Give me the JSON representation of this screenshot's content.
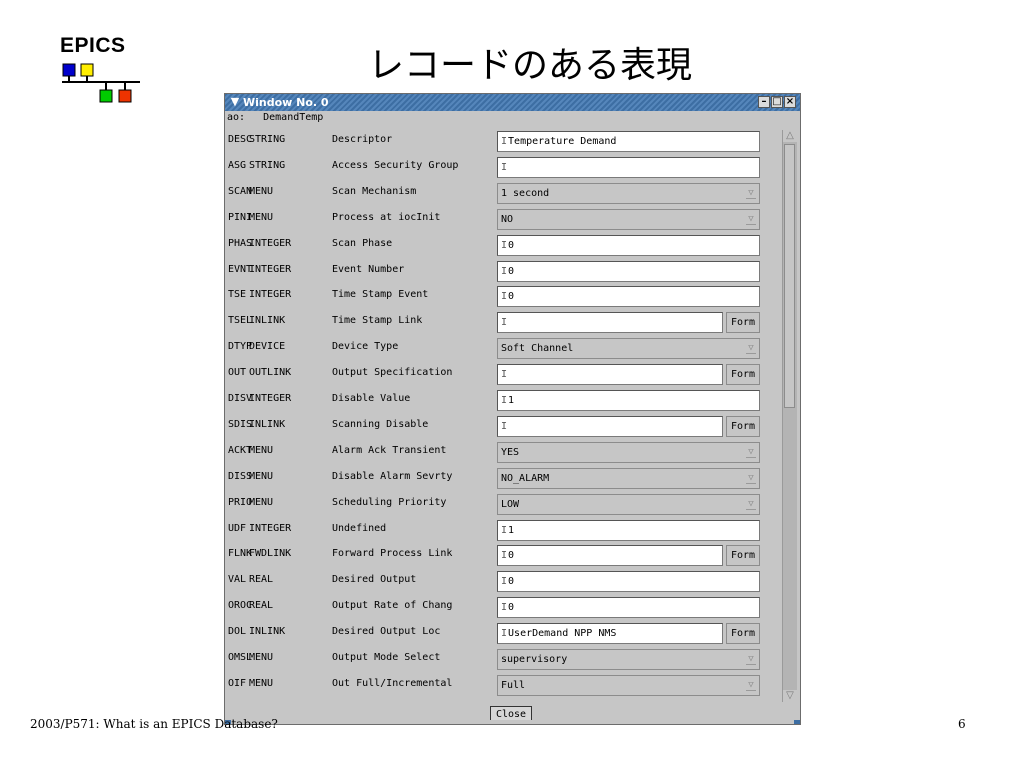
{
  "slide": {
    "logo_text": "EPICS",
    "title": "レコードのある表現",
    "footer": "2003/P571: What is an EPICS Database?",
    "page_number": "6"
  },
  "window": {
    "title": "Window No. 0",
    "record_type": "ao:",
    "record_name": "DemandTemp",
    "close_label": "Close",
    "form_label": "Form",
    "caret": "I",
    "fields": [
      {
        "name": "DESC",
        "type": "STRING",
        "desc": "Descriptor",
        "kind": "text",
        "value": "Temperature Demand"
      },
      {
        "name": "ASG",
        "type": "STRING",
        "desc": "Access Security Group",
        "kind": "text",
        "value": ""
      },
      {
        "name": "SCAN",
        "type": "MENU",
        "desc": "Scan Mechanism",
        "kind": "menu",
        "value": "1 second"
      },
      {
        "name": "PINI",
        "type": "MENU",
        "desc": "Process at iocInit",
        "kind": "menu",
        "value": "NO"
      },
      {
        "name": "PHAS",
        "type": "INTEGER",
        "desc": "Scan Phase",
        "kind": "text",
        "value": "0"
      },
      {
        "name": "EVNT",
        "type": "INTEGER",
        "desc": "Event Number",
        "kind": "text",
        "value": "0"
      },
      {
        "name": "TSE",
        "type": "INTEGER",
        "desc": "Time Stamp Event",
        "kind": "text",
        "value": "0"
      },
      {
        "name": "TSEL",
        "type": "INLINK",
        "desc": "Time Stamp Link",
        "kind": "link",
        "value": ""
      },
      {
        "name": "DTYP",
        "type": "DEVICE",
        "desc": "Device Type",
        "kind": "menu",
        "value": "Soft Channel"
      },
      {
        "name": "OUT",
        "type": "OUTLINK",
        "desc": "Output Specification",
        "kind": "link",
        "value": ""
      },
      {
        "name": "DISV",
        "type": "INTEGER",
        "desc": "Disable Value",
        "kind": "text",
        "value": "1"
      },
      {
        "name": "SDIS",
        "type": "INLINK",
        "desc": "Scanning Disable",
        "kind": "link",
        "value": ""
      },
      {
        "name": "ACKT",
        "type": "MENU",
        "desc": "Alarm Ack Transient",
        "kind": "menu",
        "value": "YES"
      },
      {
        "name": "DISS",
        "type": "MENU",
        "desc": "Disable Alarm Sevrty",
        "kind": "menu",
        "value": "NO_ALARM"
      },
      {
        "name": "PRIO",
        "type": "MENU",
        "desc": "Scheduling Priority",
        "kind": "menu",
        "value": "LOW"
      },
      {
        "name": "UDF",
        "type": "INTEGER",
        "desc": "Undefined",
        "kind": "text",
        "value": "1"
      },
      {
        "name": "FLNK",
        "type": "FWDLINK",
        "desc": "Forward Process Link",
        "kind": "link",
        "value": "0"
      },
      {
        "name": "VAL",
        "type": "REAL",
        "desc": "Desired Output",
        "kind": "text",
        "value": "0"
      },
      {
        "name": "OROC",
        "type": "REAL",
        "desc": "Output Rate of Chang",
        "kind": "text",
        "value": "0"
      },
      {
        "name": "DOL",
        "type": "INLINK",
        "desc": "Desired Output Loc",
        "kind": "link",
        "value": "UserDemand NPP NMS"
      },
      {
        "name": "OMSL",
        "type": "MENU",
        "desc": "Output Mode Select",
        "kind": "menu",
        "value": "supervisory"
      },
      {
        "name": "OIF",
        "type": "MENU",
        "desc": "Out Full/Incremental",
        "kind": "menu",
        "value": "Full"
      }
    ]
  },
  "colors": {
    "logo_blue": "#0000cc",
    "logo_yellow": "#ffee00",
    "logo_green": "#00cc00",
    "logo_red": "#ee3300",
    "titlebar": "#3d6ea3",
    "window_bg": "#c6c6c6"
  }
}
